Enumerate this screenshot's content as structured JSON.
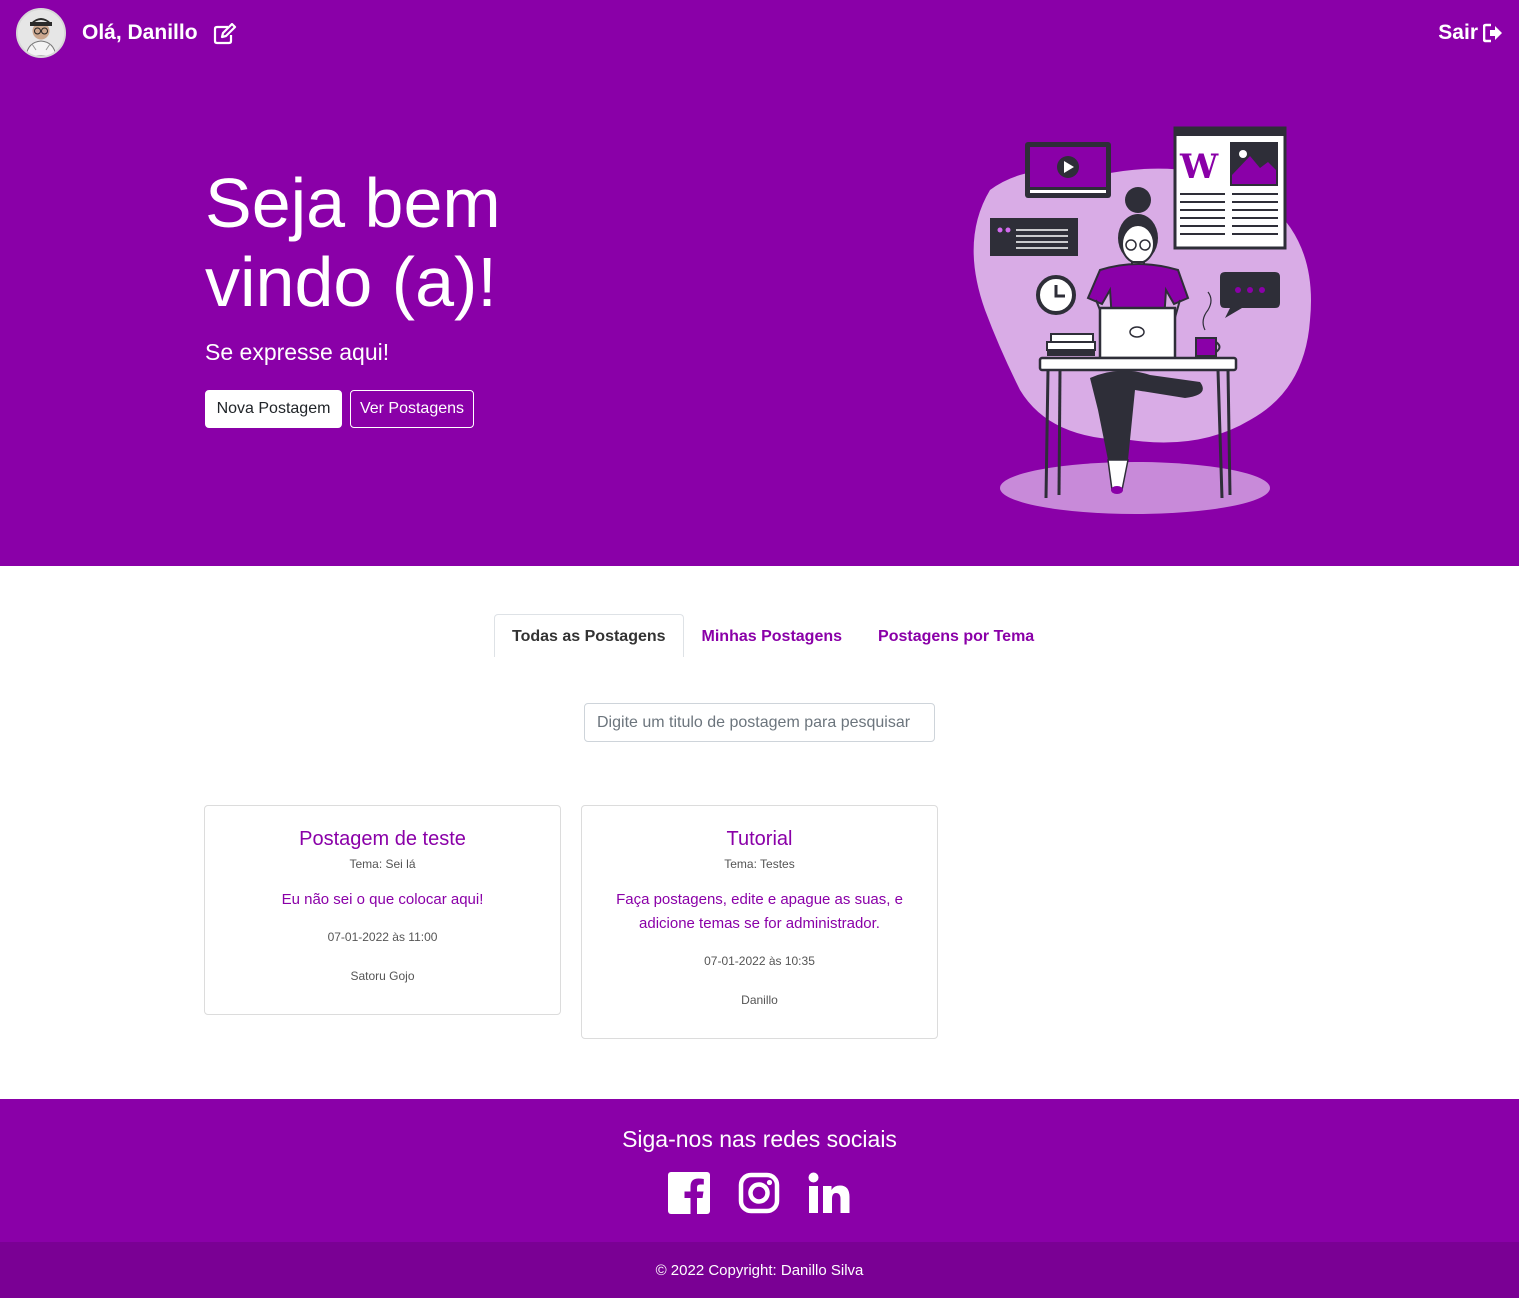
{
  "navbar": {
    "greeting": "Olá, Danillo",
    "logout_label": "Sair",
    "icons": {
      "avatar": "user-avatar",
      "edit": "pencil-square-icon",
      "logout": "sign-out-icon"
    }
  },
  "hero": {
    "title": "Seja bem vindo (a)!",
    "subtitle": "Se expresse aqui!",
    "new_post_label": "Nova Postagem",
    "see_posts_label": "Ver Postagens"
  },
  "tabs": [
    {
      "label": "Todas as Postagens",
      "active": true
    },
    {
      "label": "Minhas Postagens",
      "active": false
    },
    {
      "label": "Postagens por Tema",
      "active": false
    }
  ],
  "search": {
    "placeholder": "Digite um titulo de postagem para pesquisar",
    "value": ""
  },
  "posts": [
    {
      "title": "Postagem de teste",
      "theme": "Tema: Sei lá",
      "text": "Eu não sei o que colocar aqui!",
      "date": "07-01-2022 às 11:00",
      "author": "Satoru Gojo"
    },
    {
      "title": "Tutorial",
      "theme": "Tema: Testes",
      "text": "Faça postagens, edite e apague as suas, e adicione temas se for administrador.",
      "date": "07-01-2022 às 10:35",
      "author": "Danillo"
    }
  ],
  "footer": {
    "title": "Siga-nos nas redes sociais",
    "social_icons": [
      "facebook-icon",
      "instagram-icon",
      "linkedin-icon"
    ],
    "copyright": "© 2022 Copyright: Danillo Silva"
  },
  "colors": {
    "brand": "#8a00a8",
    "brand_dark": "#7a0094",
    "illustration_light": "#d9ace6",
    "illustration_dark": "#2e2e38"
  }
}
